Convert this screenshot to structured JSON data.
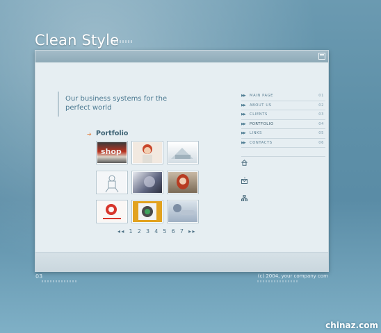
{
  "header": {
    "site_title": "Clean Style"
  },
  "hero": {
    "tagline": "Our business systems for the perfect world"
  },
  "portfolio": {
    "title": "Portfolio",
    "pager_prev": "◂◂",
    "pages": [
      "1",
      "2",
      "3",
      "4",
      "5",
      "6",
      "7"
    ],
    "pager_next": "▸▸"
  },
  "menu": {
    "items": [
      {
        "label": "MAIN PAGE",
        "num": "01",
        "active": false
      },
      {
        "label": "ABOUT US",
        "num": "02",
        "active": false
      },
      {
        "label": "CLIENTS",
        "num": "03",
        "active": false
      },
      {
        "label": "PORTFOLIO",
        "num": "04",
        "active": true
      },
      {
        "label": "LINKS",
        "num": "05",
        "active": false
      },
      {
        "label": "CONTACTS",
        "num": "06",
        "active": false
      }
    ]
  },
  "side_icons": [
    "home-icon",
    "mail-icon",
    "sitemap-icon"
  ],
  "footer": {
    "page_num": "03",
    "copyright": "(c) 2004, your company com"
  },
  "watermark": "chinaz.com",
  "colors": {
    "accent": "#e28a50",
    "text": "#4a7890",
    "window_bar": "#9cb6c3"
  }
}
